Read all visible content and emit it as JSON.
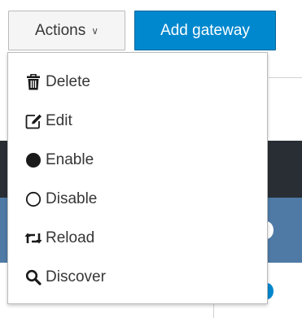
{
  "toolbar": {
    "actions_label": "Actions",
    "actions_caret": "∨",
    "add_gateway_label": "Add gateway"
  },
  "menu": {
    "items": [
      {
        "label": "Delete",
        "icon": "trash-icon"
      },
      {
        "label": "Edit",
        "icon": "edit-icon"
      },
      {
        "label": "Enable",
        "icon": "filled-circle-icon"
      },
      {
        "label": "Disable",
        "icon": "empty-circle-icon"
      },
      {
        "label": "Reload",
        "icon": "retweet-icon"
      },
      {
        "label": "Discover",
        "icon": "search-icon"
      }
    ]
  },
  "colors": {
    "primary": "#0088ce",
    "menu_border": "#bbbbbb",
    "text": "#363636",
    "dark_row": "#292e34",
    "selected_row": "#4f7aa5"
  }
}
